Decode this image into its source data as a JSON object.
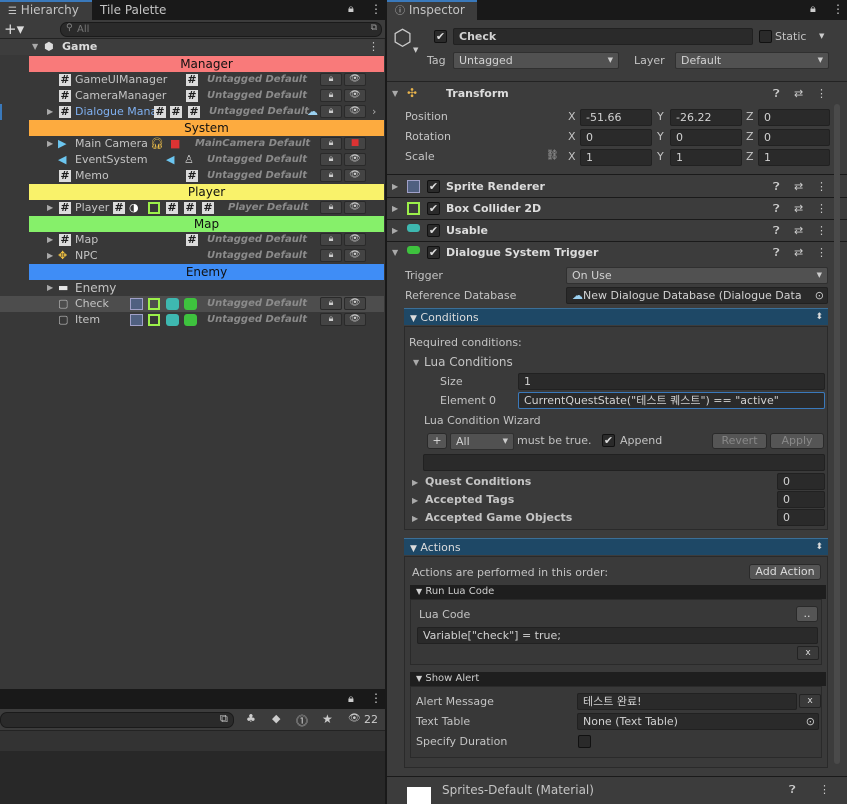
{
  "hierarchy": {
    "tabs": [
      "Hierarchy",
      "Tile Palette"
    ],
    "search_placeholder": "All",
    "scene_name": "Game",
    "banners": {
      "manager": "Manager",
      "system": "System",
      "player": "Player",
      "map": "Map",
      "enemy": "Enemy"
    },
    "rows": {
      "gameui": {
        "name": "GameUIManager",
        "tag": "Untagged Default"
      },
      "camera_mgr": {
        "name": "CameraManager",
        "tag": "Untagged Default"
      },
      "dialogue_mgr": {
        "name": "Dialogue Manag",
        "tag": "Untagged Default"
      },
      "main_camera": {
        "name": "Main Camera",
        "tag": "MainCamera Default"
      },
      "event_system": {
        "name": "EventSystem",
        "tag": "Untagged Default"
      },
      "memo": {
        "name": "Memo",
        "tag": "Untagged Default"
      },
      "player": {
        "name": "Player",
        "tag": "Player Default"
      },
      "map": {
        "name": "Map",
        "tag": "Untagged Default"
      },
      "npc": {
        "name": "NPC",
        "tag": "Untagged Default"
      },
      "enemy": {
        "name": "Enemy"
      },
      "check": {
        "name": "Check",
        "tag": "Untagged Default"
      },
      "item": {
        "name": "Item",
        "tag": "Untagged Default"
      }
    },
    "banner_colors": {
      "manager": "#f97a7a",
      "system": "#fdab3f",
      "player": "#f9f26a",
      "map": "#86f06a",
      "enemy": "#3f8df6"
    }
  },
  "bottom_panel": {
    "count": "22"
  },
  "inspector": {
    "tab": "Inspector",
    "object_name": "Check",
    "static_label": "Static",
    "tag_label": "Tag",
    "tag_value": "Untagged",
    "layer_label": "Layer",
    "layer_value": "Default",
    "transform": {
      "title": "Transform",
      "position_label": "Position",
      "rotation_label": "Rotation",
      "scale_label": "Scale",
      "position": {
        "x": "-51.66",
        "y": "-26.22",
        "z": "0"
      },
      "rotation": {
        "x": "0",
        "y": "0",
        "z": "0"
      },
      "scale": {
        "x": "1",
        "y": "1",
        "z": "1"
      },
      "axis_x": "X",
      "axis_y": "Y",
      "axis_z": "Z"
    },
    "components": {
      "sprite_renderer": "Sprite Renderer",
      "box_collider": "Box Collider 2D",
      "usable": "Usable",
      "dialogue_trigger": "Dialogue System Trigger"
    },
    "trigger": {
      "trigger_label": "Trigger",
      "trigger_value": "On Use",
      "refdb_label": "Reference Database",
      "refdb_value": "New Dialogue Database (Dialogue Data"
    },
    "conditions": {
      "title": "Conditions",
      "required": "Required conditions:",
      "lua_conditions": "Lua Conditions",
      "size_label": "Size",
      "size_value": "1",
      "element0_label": "Element 0",
      "element0_value": "CurrentQuestState(\"테스트 퀘스트\") == \"active\"",
      "wizard_label": "Lua Condition Wizard",
      "plus": "+",
      "all_value": "All",
      "must_be_true": "must be true.",
      "append": "Append",
      "revert": "Revert",
      "apply": "Apply",
      "quest_conditions": "Quest Conditions",
      "quest_count": "0",
      "accepted_tags": "Accepted Tags",
      "tags_count": "0",
      "accepted_objects": "Accepted Game Objects",
      "objects_count": "0"
    },
    "actions": {
      "title": "Actions",
      "order_text": "Actions are performed in this order:",
      "add_action": "Add Action",
      "run_lua": "Run Lua Code",
      "lua_code_label": "Lua Code",
      "dots": "..",
      "lua_code_value": "Variable[\"check\"] = true;",
      "x": "x",
      "show_alert": "Show Alert",
      "alert_message_label": "Alert Message",
      "alert_message_value": "테스트 완료!",
      "text_table_label": "Text Table",
      "text_table_value": "None (Text Table)",
      "specify_duration_label": "Specify Duration"
    },
    "material": "Sprites-Default (Material)"
  }
}
